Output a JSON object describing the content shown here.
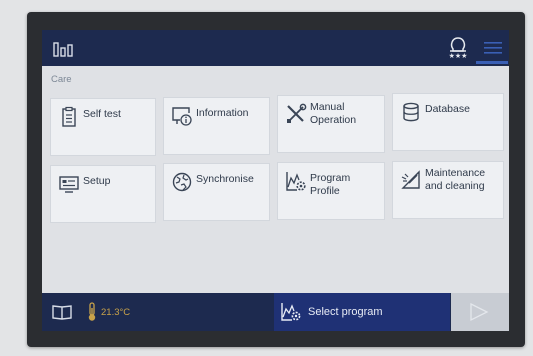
{
  "section": {
    "label": "Care"
  },
  "tiles": [
    {
      "label": "Self test",
      "icon": "clipboard-checklist-icon"
    },
    {
      "label": "Information",
      "icon": "monitor-info-icon"
    },
    {
      "label": "Manual\nOperation",
      "icon": "wrench-screwdriver-icon"
    },
    {
      "label": "Database",
      "icon": "database-icon"
    },
    {
      "label": "Setup",
      "icon": "settings-panel-icon"
    },
    {
      "label": "Synchronise",
      "icon": "globe-sync-icon"
    },
    {
      "label": "Program Profile",
      "icon": "program-chart-gear-icon"
    },
    {
      "label": "Maintenance\nand cleaning",
      "icon": "cleaning-brush-icon"
    }
  ],
  "footer": {
    "temperature": "21.3°C",
    "select_program": "Select program"
  },
  "colors": {
    "bar": "#1d2a4f",
    "select_button": "#1f3175",
    "tile": "#eef0f3",
    "temperature": "#c8a24a"
  }
}
